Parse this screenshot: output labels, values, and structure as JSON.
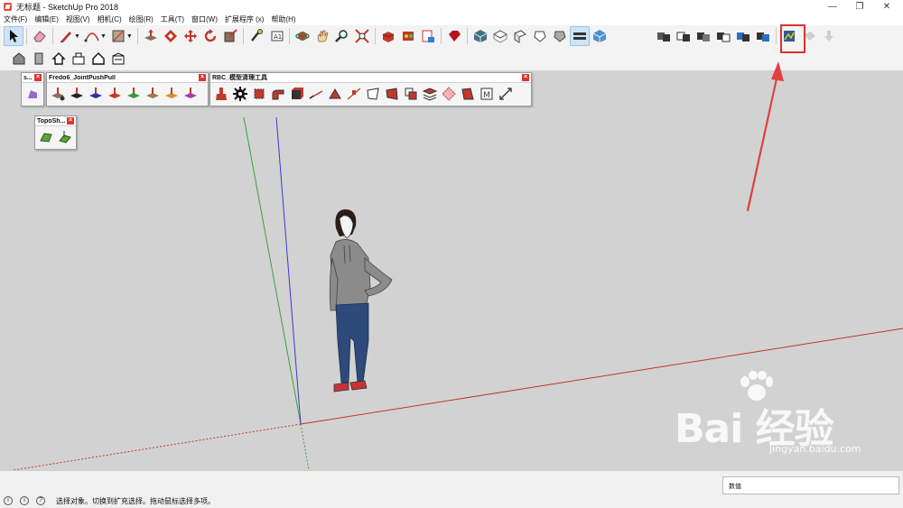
{
  "window": {
    "title": "无标题 - SketchUp Pro 2018",
    "minimize": "—",
    "restore": "❐",
    "close": "✕"
  },
  "menu": [
    "文件(F)",
    "编辑(E)",
    "视图(V)",
    "相机(C)",
    "绘图(R)",
    "工具(T)",
    "窗口(W)",
    "扩展程序 (x)",
    "帮助(H)"
  ],
  "floating_toolbars": {
    "small_panel": {
      "title": "s..."
    },
    "joint_push_pull": {
      "title": "Fredo6_JointPushPull"
    },
    "rbc": {
      "title": "RBC_模型清理工具"
    },
    "topo": {
      "title": "TopoSh..."
    },
    "close_glyph": "×"
  },
  "colors": {
    "viewport_bg": "#d2d2d2",
    "axis_red": "#c0392b",
    "axis_green": "#3aa33a",
    "axis_blue": "#3a3ad0",
    "highlight_box": "#e03030",
    "arrow": "#e04040"
  },
  "status": {
    "message": "选择对象。切换到扩充选择。拖动鼠标选择多项。",
    "measurement_label": "数值"
  },
  "watermark": {
    "text": "Bai 经验",
    "url": "jingyan.baidu.com"
  }
}
